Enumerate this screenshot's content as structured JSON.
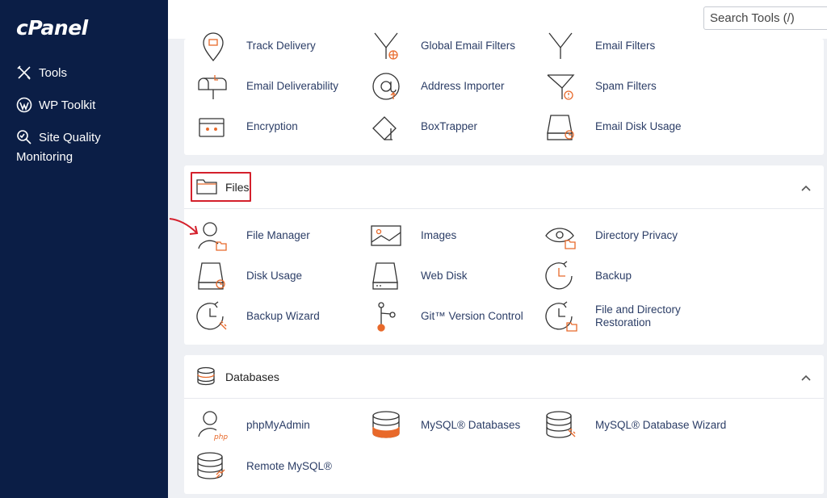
{
  "brand": {
    "logo": "cPanel"
  },
  "sidebar": {
    "items": [
      {
        "label": "Tools",
        "icon": "tools-icon"
      },
      {
        "label": "WP Toolkit",
        "icon": "wordpress-icon"
      },
      {
        "label": "Site Quality",
        "label2": "Monitoring",
        "icon": "magnifier-icon"
      }
    ]
  },
  "header": {
    "search_placeholder": "Search Tools (/)"
  },
  "email": {
    "tools": [
      "Track Delivery",
      "Global Email Filters",
      "Email Filters",
      "Email Deliverability",
      "Address Importer",
      "Spam Filters",
      "Encryption",
      "BoxTrapper",
      "Email Disk Usage"
    ]
  },
  "files": {
    "title": "Files",
    "tools": [
      "File Manager",
      "Images",
      "Directory Privacy",
      "Disk Usage",
      "Web Disk",
      "Backup",
      "Backup Wizard",
      "Git™ Version Control",
      "File and Directory Restoration"
    ]
  },
  "databases": {
    "title": "Databases",
    "tools": [
      "phpMyAdmin",
      "MySQL® Databases",
      "MySQL® Database Wizard",
      "Remote MySQL®"
    ],
    "icon_badge": "php"
  },
  "colors": {
    "sidebar": "#0b1e46",
    "accent": "#e8692a",
    "highlight": "#d4202c",
    "link": "#2b3d66"
  }
}
